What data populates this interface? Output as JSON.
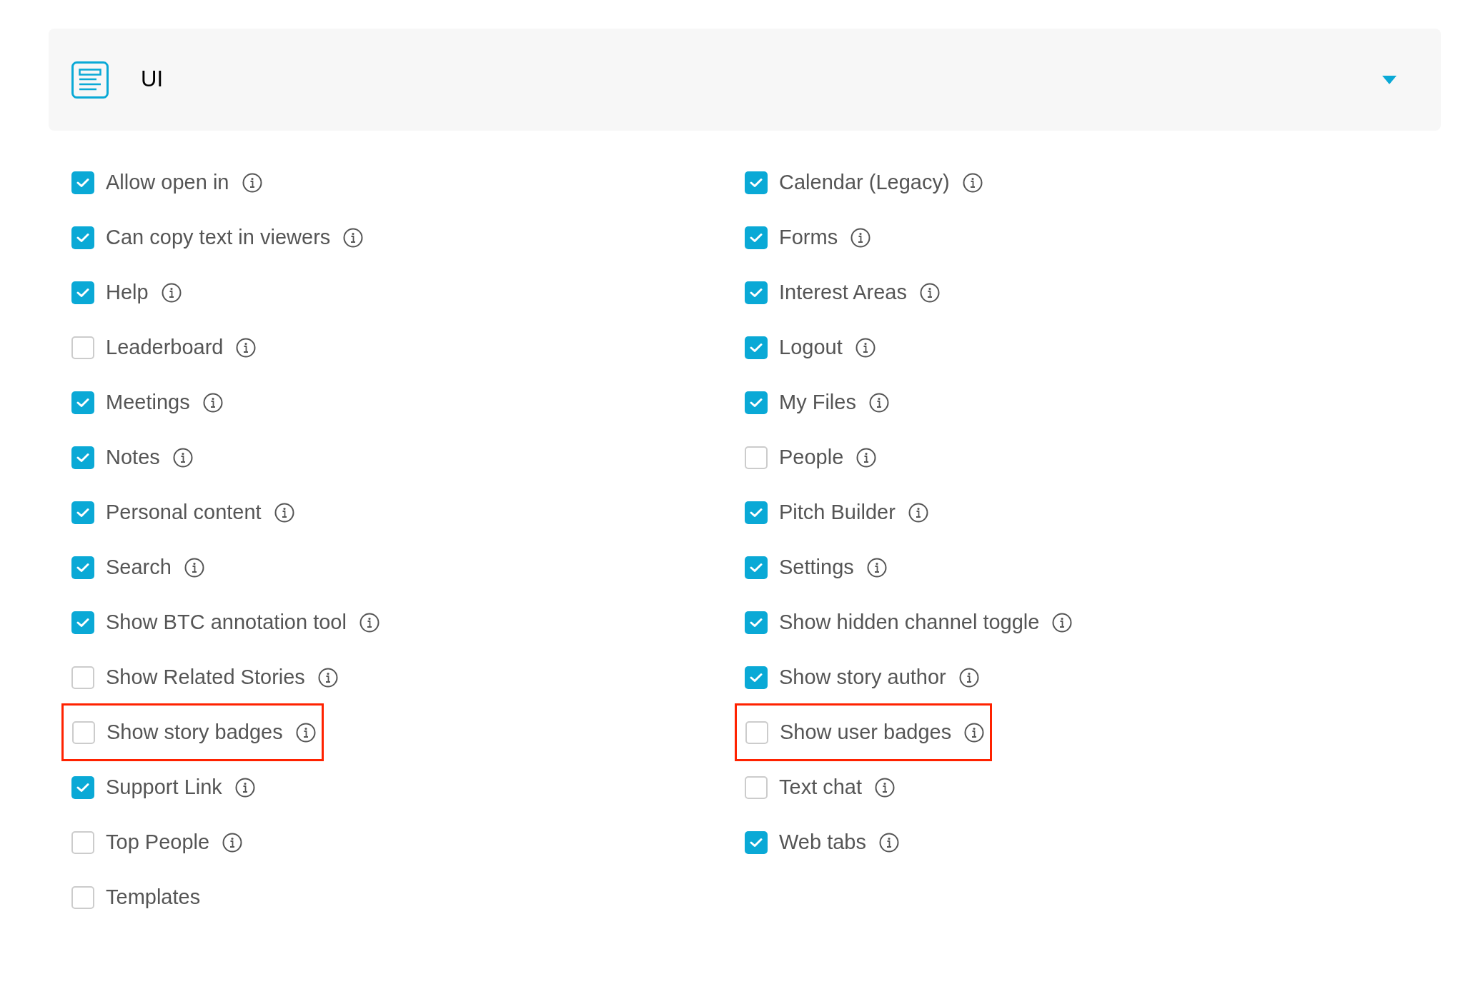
{
  "panel": {
    "title": "UI",
    "expanded": true
  },
  "columns": [
    [
      {
        "label": "Allow open in",
        "checked": true,
        "info": true,
        "highlighted": false
      },
      {
        "label": "Can copy text in viewers",
        "checked": true,
        "info": true,
        "highlighted": false
      },
      {
        "label": "Help",
        "checked": true,
        "info": true,
        "highlighted": false
      },
      {
        "label": "Leaderboard",
        "checked": false,
        "info": true,
        "highlighted": false
      },
      {
        "label": "Meetings",
        "checked": true,
        "info": true,
        "highlighted": false
      },
      {
        "label": "Notes",
        "checked": true,
        "info": true,
        "highlighted": false
      },
      {
        "label": "Personal content",
        "checked": true,
        "info": true,
        "highlighted": false
      },
      {
        "label": "Search",
        "checked": true,
        "info": true,
        "highlighted": false
      },
      {
        "label": "Show BTC annotation tool",
        "checked": true,
        "info": true,
        "highlighted": false
      },
      {
        "label": "Show Related Stories",
        "checked": false,
        "info": true,
        "highlighted": false
      },
      {
        "label": "Show story badges",
        "checked": false,
        "info": true,
        "highlighted": true
      },
      {
        "label": "Support Link",
        "checked": true,
        "info": true,
        "highlighted": false
      },
      {
        "label": "Top People",
        "checked": false,
        "info": true,
        "highlighted": false
      },
      {
        "label": "Templates",
        "checked": false,
        "info": false,
        "highlighted": false
      }
    ],
    [
      {
        "label": "Calendar (Legacy)",
        "checked": true,
        "info": true,
        "highlighted": false
      },
      {
        "label": "Forms",
        "checked": true,
        "info": true,
        "highlighted": false
      },
      {
        "label": "Interest Areas",
        "checked": true,
        "info": true,
        "highlighted": false
      },
      {
        "label": "Logout",
        "checked": true,
        "info": true,
        "highlighted": false
      },
      {
        "label": "My Files",
        "checked": true,
        "info": true,
        "highlighted": false
      },
      {
        "label": "People",
        "checked": false,
        "info": true,
        "highlighted": false
      },
      {
        "label": "Pitch Builder",
        "checked": true,
        "info": true,
        "highlighted": false
      },
      {
        "label": "Settings",
        "checked": true,
        "info": true,
        "highlighted": false
      },
      {
        "label": "Show hidden channel toggle",
        "checked": true,
        "info": true,
        "highlighted": false
      },
      {
        "label": "Show story author",
        "checked": true,
        "info": true,
        "highlighted": false
      },
      {
        "label": "Show user badges",
        "checked": false,
        "info": true,
        "highlighted": true
      },
      {
        "label": "Text chat",
        "checked": false,
        "info": true,
        "highlighted": false
      },
      {
        "label": "Web tabs",
        "checked": true,
        "info": true,
        "highlighted": false
      }
    ]
  ]
}
